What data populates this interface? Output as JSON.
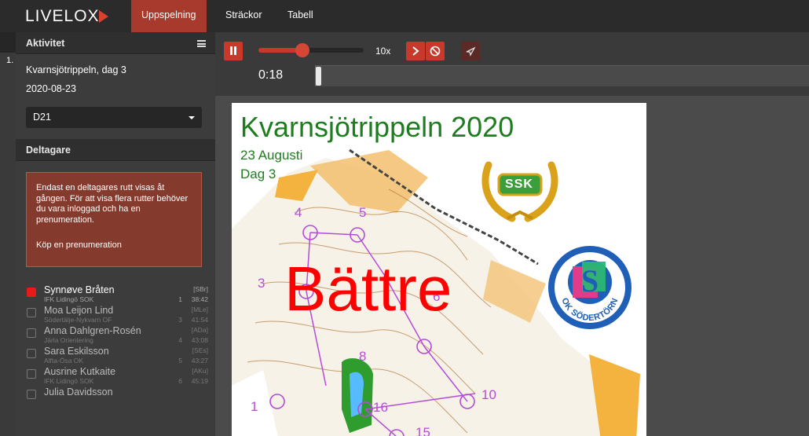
{
  "app": {
    "logo_text": "LIVELOX"
  },
  "nav": {
    "tabs": [
      {
        "label": "Uppspelning"
      },
      {
        "label": "Sträckor"
      },
      {
        "label": "Tabell"
      }
    ]
  },
  "left_strip": {
    "number": "1."
  },
  "sidebar": {
    "activity_header": "Aktivitet",
    "activity_name": "Kvarnsjötrippeln, dag 3",
    "activity_date": "2020-08-23",
    "class_selected": "D21",
    "participants_header": "Deltagare",
    "notice_text": "Endast en deltagares rutt visas åt gången. För att visa flera rutter behöver du vara inloggad och ha en prenumeration.",
    "notice_link": "Köp en prenumeration",
    "runners": [
      {
        "name": "Synnøve Bråten",
        "club": "IFK Lidingö SOK",
        "abbr": "[SBr]",
        "rank": "1",
        "time": "38:42",
        "selected": true
      },
      {
        "name": "Moa Leijon Lind",
        "club": "Södertälje-Nykvarn OF",
        "abbr": "[MLe]",
        "rank": "3",
        "time": "41:54",
        "selected": false
      },
      {
        "name": "Anna Dahlgren-Rosén",
        "club": "Järla Orientering",
        "abbr": "[ADa]",
        "rank": "4",
        "time": "43:08",
        "selected": false
      },
      {
        "name": "Sara Eskilsson",
        "club": "Alfta-Ösa OK",
        "abbr": "[SEs]",
        "rank": "5",
        "time": "43:27",
        "selected": false
      },
      {
        "name": "Ausrine Kutkaite",
        "club": "IFK Lidingö SOK",
        "abbr": "[AKu]",
        "rank": "6",
        "time": "45:19",
        "selected": false
      },
      {
        "name": "Julia Davidsson",
        "club": "",
        "abbr": "",
        "rank": "",
        "time": "",
        "selected": false
      }
    ]
  },
  "controls": {
    "speed_label": "10x",
    "speed_fraction": 0.42,
    "clock": "0:18",
    "timeline_fraction": 0.0
  },
  "map": {
    "title": "Kvarnsjötrippeln 2020",
    "subtitle_date": "23 Augusti",
    "subtitle_day": "Dag 3",
    "watermark": "Bättre",
    "club_logo_1": "SSK",
    "club_logo_2_letter": "S",
    "club_logo_2_text": "OK SÖDERTÖRN",
    "control_numbers": [
      "4",
      "5",
      "3",
      "6",
      "8",
      "1",
      "16",
      "10",
      "15"
    ]
  },
  "colors": {
    "accent": "#c8392b",
    "active_tab": "#a83a2d",
    "notice_bg": "#853a2e",
    "map_title": "#1e7d1e",
    "watermark": "#ff0000",
    "course": "#b44cd8"
  }
}
